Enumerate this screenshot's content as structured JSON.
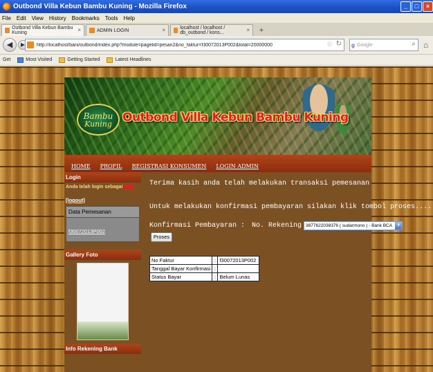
{
  "browser": {
    "window_title": "Outbond Villa Kebun Bambu Kuning - Mozilla Firefox",
    "menu": [
      "File",
      "Edit",
      "View",
      "History",
      "Bookmarks",
      "Tools",
      "Help"
    ],
    "tabs": [
      {
        "label": "Outbond Villa Kebun Bambu Kuning"
      },
      {
        "label": "ADMIN LOGIN"
      },
      {
        "label": "localhost / localhost / db_outbond / kons..."
      }
    ],
    "url": "http://localhost/bani/outbond/index.php?module=pagelid=pesan2&no_faktur=f30072013P002&total=20000000",
    "search_placeholder": "Google",
    "bookmarks": [
      "Get",
      "Most Visited",
      "Getting Started",
      "Latest Headlines"
    ]
  },
  "site": {
    "logo_line1": "Bambu",
    "logo_line2": "Kuning",
    "title": "Outbond Villa Kebun Bambu Kuning",
    "nav": [
      "HOME",
      "PROFIL",
      "REGISTRASI KONSUMEN",
      "LOGIN ADMIN"
    ]
  },
  "sidebar": {
    "login_head": "Login",
    "login_text": "Anda telah login sebagai",
    "logout": "[logout]",
    "menu_title": "Data Pemesanan",
    "menu_link": "f30072013P002",
    "gallery_head": "Gallery Foto",
    "bank_head": "Info Rekening Bank"
  },
  "content": {
    "msg1": "Terima kasih anda telah melakukan transaksi pemesanan",
    "msg2": "Untuk melakukan konfirmasi pembayaran silakan klik tombol proses....",
    "konf_label": "Konfirmasi Pembayaran :",
    "rek_label": "No. Rekening",
    "rek_selected": "3877622038376 ( sudarmono ) - Bank BCA",
    "proses_label": "Proses",
    "info_rows": [
      {
        "key": "No Faktur",
        "value": "f30072013P002"
      },
      {
        "key": "Tanggal Bayar Konfirmasi",
        "value": ""
      },
      {
        "key": "Status Bayar",
        "value": "Belum Lunas"
      }
    ]
  }
}
